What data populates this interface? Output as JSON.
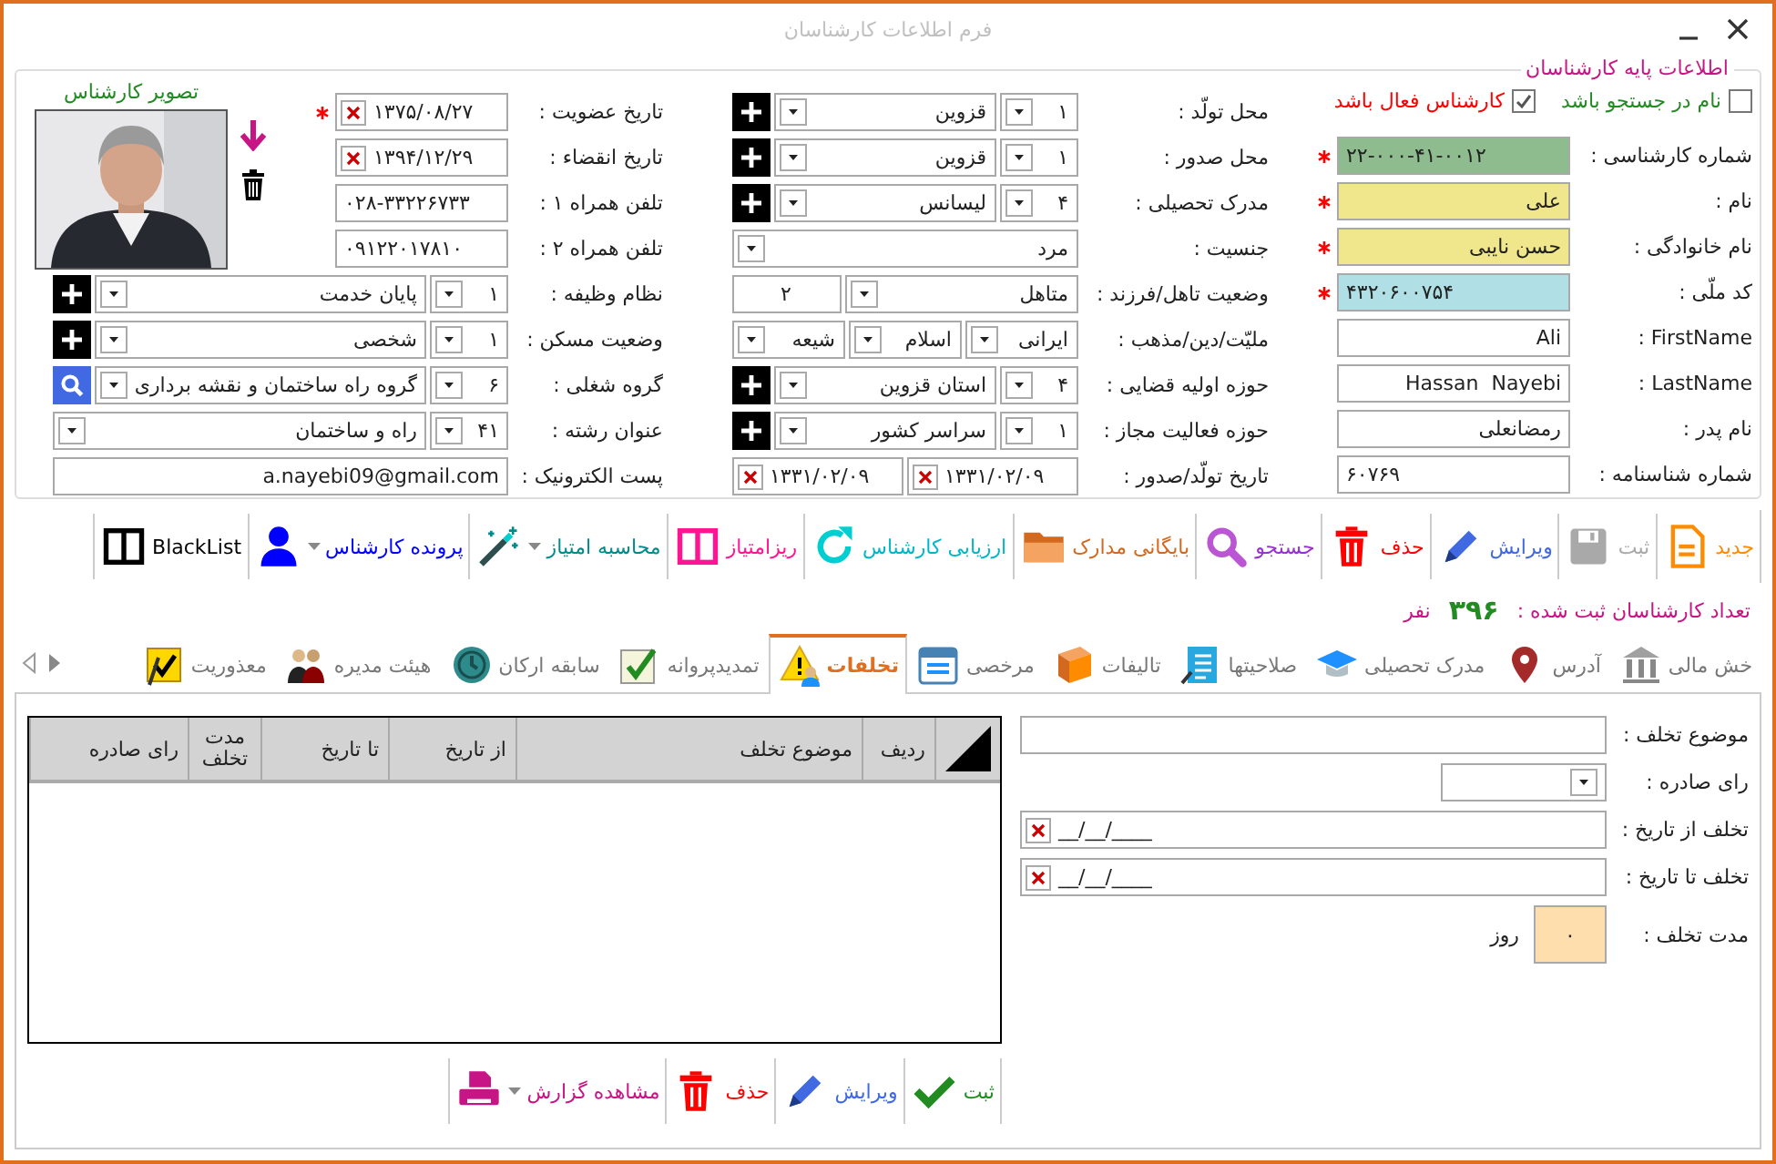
{
  "window": {
    "title": "فرم اطلاعات کارشناسان"
  },
  "basic_info": {
    "legend": "اطلاعات پایه کارشناسان",
    "checkboxes": [
      {
        "label": "نام در جستجو باشد",
        "checked": false,
        "color": "#228b22"
      },
      {
        "label": "کارشناس فعال باشد",
        "checked": true,
        "color": "#ff0000"
      }
    ],
    "right_fields": [
      {
        "label": "شماره کارشناسی :",
        "required": true,
        "controls": [
          {
            "kind": "number",
            "value": "۲۲-۰۰۰-۴۱-۰۰۱۲",
            "color": "#8fbc8f"
          }
        ]
      },
      {
        "label": "نام :",
        "required": true,
        "controls": [
          {
            "kind": "text",
            "value": "علی",
            "color": "#f0e68c"
          }
        ]
      },
      {
        "label": "نام خانوادگی :",
        "required": true,
        "controls": [
          {
            "kind": "text",
            "value": "حسن نایبی",
            "color": "#f0e68c"
          }
        ]
      },
      {
        "label": "کد ملّی :",
        "required": true,
        "controls": [
          {
            "kind": "number",
            "value": "۴۳۲۰۶۰۰۷۵۴",
            "color": "#b0dfe5"
          }
        ]
      },
      {
        "label": "FirstName :",
        "required": false,
        "controls": [
          {
            "kind": "text",
            "value": "Ali"
          }
        ]
      },
      {
        "label": "LastName :",
        "required": false,
        "controls": [
          {
            "kind": "text",
            "value": "Hassan  Nayebi"
          }
        ]
      },
      {
        "label": "نام پدر :",
        "required": false,
        "controls": [
          {
            "kind": "text",
            "value": "رمضانعلی"
          }
        ]
      },
      {
        "label": "شماره شناسنامه :",
        "required": false,
        "controls": [
          {
            "kind": "number",
            "value": "۶۰۷۶۹"
          }
        ]
      }
    ],
    "middle_fields": [
      {
        "label": "محل تولّد :",
        "required": false,
        "controls": [
          {
            "kind": "code",
            "value": "۱"
          },
          {
            "kind": "combo",
            "value": "قزوین"
          },
          {
            "kind": "add"
          }
        ]
      },
      {
        "label": "محل صدور :",
        "required": false,
        "controls": [
          {
            "kind": "code",
            "value": "۱"
          },
          {
            "kind": "combo",
            "value": "قزوین"
          },
          {
            "kind": "add"
          }
        ]
      },
      {
        "label": "مدرک تحصیلی :",
        "required": false,
        "controls": [
          {
            "kind": "code",
            "value": "۴"
          },
          {
            "kind": "combo",
            "value": "لیسانس"
          },
          {
            "kind": "add"
          }
        ]
      },
      {
        "label": "جنسیت :",
        "required": false,
        "controls": [
          {
            "kind": "combo",
            "value": "مرد"
          }
        ]
      },
      {
        "label": "وضعیت تاهل/فرزند :",
        "required": false,
        "controls": [
          {
            "kind": "combo",
            "value": "متاهل"
          },
          {
            "kind": "count",
            "value": "۲"
          }
        ]
      },
      {
        "label": "ملیّت/دین/مذهب :",
        "required": false,
        "controls": [
          {
            "kind": "combo",
            "value": "ایرانی"
          },
          {
            "kind": "combo",
            "value": "اسلام"
          },
          {
            "kind": "combo",
            "value": "شیعه"
          }
        ]
      },
      {
        "label": "حوزه اولیه قضایی :",
        "required": false,
        "controls": [
          {
            "kind": "code",
            "value": "۴"
          },
          {
            "kind": "combo",
            "value": "استان قزوین"
          },
          {
            "kind": "add"
          }
        ]
      },
      {
        "label": "حوزه فعالیت مجاز :",
        "required": false,
        "controls": [
          {
            "kind": "code",
            "value": "۱"
          },
          {
            "kind": "combo",
            "value": "سراسر کشور"
          },
          {
            "kind": "add"
          }
        ]
      },
      {
        "label": "تاریخ تولّد/صدور :",
        "required": false,
        "controls": [
          {
            "kind": "date",
            "value": "۱۳۳۱/۰۲/۰۹"
          },
          {
            "kind": "date",
            "value": "۱۳۳۱/۰۲/۰۹"
          }
        ]
      }
    ],
    "photo": {
      "caption": "تصویر کارشناس"
    },
    "left_fields": [
      {
        "label": "تاریخ عضویت :",
        "required": true,
        "controls": [
          {
            "kind": "date",
            "value": "۱۳۷۵/۰۸/۲۷"
          }
        ]
      },
      {
        "label": "تاریخ انقضاء :",
        "required": false,
        "controls": [
          {
            "kind": "date",
            "value": "۱۳۹۴/۱۲/۲۹"
          }
        ]
      },
      {
        "label": "تلفن همراه ۱ :",
        "required": false,
        "controls": [
          {
            "kind": "number",
            "value": "۰۲۸-۳۳۲۲۶۷۳۳"
          }
        ]
      },
      {
        "label": "تلفن همراه ۲ :",
        "required": false,
        "controls": [
          {
            "kind": "number",
            "value": "۰۹۱۲۲۰۱۷۸۱۰"
          }
        ]
      },
      {
        "label": "نظام وظیفه :",
        "required": false,
        "controls": [
          {
            "kind": "code",
            "value": "۱"
          },
          {
            "kind": "combo",
            "value": "پایان خدمت"
          },
          {
            "kind": "add"
          }
        ]
      },
      {
        "label": "وضعیت مسکن :",
        "required": false,
        "controls": [
          {
            "kind": "code",
            "value": "۱"
          },
          {
            "kind": "combo",
            "value": "شخصی"
          },
          {
            "kind": "add"
          }
        ]
      },
      {
        "label": "گروه شغلی :",
        "required": false,
        "controls": [
          {
            "kind": "code",
            "value": "۶"
          },
          {
            "kind": "combo",
            "value": "گروه راه ساختمان و نقشه برداری"
          },
          {
            "kind": "search"
          }
        ]
      },
      {
        "label": "عنوان رشته :",
        "required": false,
        "controls": [
          {
            "kind": "code",
            "value": "۴۱"
          },
          {
            "kind": "combo",
            "value": "راه و ساختمان"
          }
        ]
      },
      {
        "label": "پست الکترونیک :",
        "required": false,
        "controls": [
          {
            "kind": "text",
            "value": "a.nayebi09@gmail.com"
          }
        ]
      }
    ]
  },
  "toolbar": [
    {
      "label": "جدید",
      "color": "#ff8c00",
      "disabled": false,
      "dropdown": false
    },
    {
      "label": "ثبت",
      "disabled": true,
      "dropdown": false
    },
    {
      "label": "ویرایش",
      "color": "#4169e1",
      "disabled": false,
      "dropdown": false
    },
    {
      "label": "حذف",
      "color": "#ff0000",
      "disabled": false,
      "dropdown": false
    },
    {
      "label": "جستجو",
      "color": "#9932cc",
      "disabled": false,
      "dropdown": false
    },
    {
      "label": "بایگانی مدارک",
      "color": "#d2691e",
      "disabled": false,
      "dropdown": false
    },
    {
      "label": "ارزیابی کارشناس",
      "color": "#00b8c8",
      "disabled": false,
      "dropdown": false
    },
    {
      "label": "ریزامتیاز",
      "color": "#ff1493",
      "disabled": false,
      "dropdown": false
    },
    {
      "label": "محاسبه امتیاز",
      "color": "#008b8b",
      "disabled": false,
      "dropdown": true
    },
    {
      "label": "پرونده کارشناس",
      "color": "#0000ff",
      "disabled": false,
      "dropdown": true
    },
    {
      "label": "BlackList",
      "color": "#000000",
      "disabled": false,
      "dropdown": false
    }
  ],
  "counter": {
    "label": "تعداد کارشناسان ثبت شده :",
    "count": "۳۹۶",
    "unit": "نفر"
  },
  "tabs": [
    {
      "label": "خش مالی",
      "selected": false
    },
    {
      "label": "آدرس",
      "selected": false
    },
    {
      "label": "مدرک تحصیلی",
      "selected": false
    },
    {
      "label": "صلاحیتها",
      "selected": false
    },
    {
      "label": "تالیفات",
      "selected": false
    },
    {
      "label": "مرخصی",
      "selected": false
    },
    {
      "label": "تخلفات",
      "selected": true
    },
    {
      "label": "تمدیدپروانه",
      "selected": false
    },
    {
      "label": "سابقه ارکان",
      "selected": false
    },
    {
      "label": "هیئت مدیره",
      "selected": false
    },
    {
      "label": "معذوریت",
      "selected": false
    }
  ],
  "violation_form": [
    {
      "label": "موضوع تخلف :",
      "kind": "text"
    },
    {
      "label": "رای صادره :",
      "kind": "combo"
    },
    {
      "label": "تخلف از تاریخ :",
      "kind": "date",
      "value": "__/__/____"
    },
    {
      "label": "تخلف تا تاریخ :",
      "kind": "date",
      "value": "__/__/____"
    },
    {
      "label": "مدت تخلف :",
      "kind": "days",
      "value": "۰",
      "unit": "روز"
    }
  ],
  "violations_table": {
    "columns": [
      "ردیف",
      "موضوع تخلف",
      "از تاریخ",
      "تا تاریخ",
      "مدت تخلف",
      "رای صادره"
    ]
  },
  "bottom_toolbar": [
    {
      "label": "ثبت",
      "color": "#228b22",
      "dropdown": false
    },
    {
      "label": "ویرایش",
      "color": "#4169e1",
      "dropdown": false
    },
    {
      "label": "حذف",
      "color": "#ff0000",
      "dropdown": false
    },
    {
      "label": "مشاهده گزارش",
      "color": "#c71585",
      "dropdown": true
    }
  ]
}
